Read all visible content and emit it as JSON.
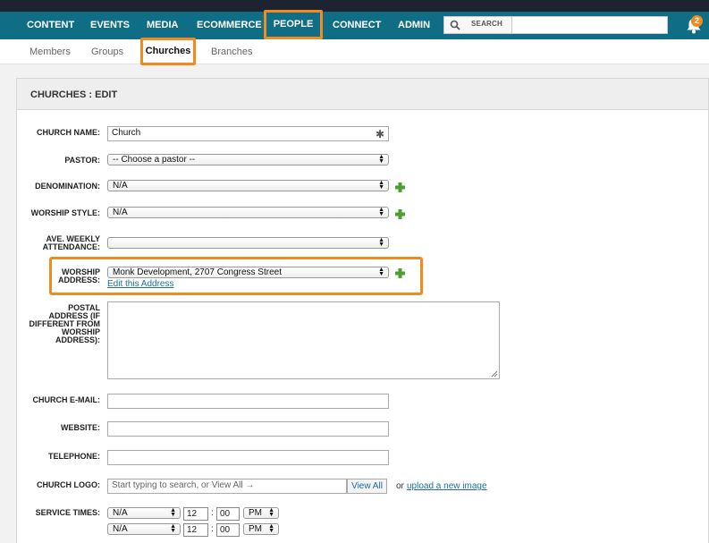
{
  "nav": {
    "items": [
      "CONTENT",
      "EVENTS",
      "MEDIA",
      "ECOMMERCE",
      "PEOPLE",
      "CONNECT",
      "ADMIN"
    ],
    "search_label": "SEARCH",
    "search_value": "",
    "notification_count": "2"
  },
  "subnav": {
    "items": [
      "Members",
      "Groups",
      "Churches",
      "Branches"
    ],
    "active": "Churches"
  },
  "panel": {
    "title": "CHURCHES : EDIT"
  },
  "form": {
    "church_name": {
      "label": "CHURCH NAME:",
      "value": "Church",
      "required_icon": "asterisk-icon"
    },
    "pastor": {
      "label": "PASTOR:",
      "value": "-- Choose a pastor --"
    },
    "denomination": {
      "label": "DENOMINATION:",
      "value": "N/A"
    },
    "worship_style": {
      "label": "WORSHIP STYLE:",
      "value": "N/A"
    },
    "attendance": {
      "label_line1": "AVE. WEEKLY",
      "label_line2": "ATTENDANCE:",
      "value": ""
    },
    "worship_address": {
      "label_line1": "WORSHIP",
      "label_line2": "ADDRESS:",
      "value": "Monk Development, 2707 Congress Street",
      "edit_link": "Edit this Address"
    },
    "postal_address": {
      "label_lines": [
        "POSTAL",
        "ADDRESS (IF",
        "DIFFERENT FROM",
        "WORSHIP",
        "ADDRESS):"
      ],
      "value": ""
    },
    "email": {
      "label": "CHURCH E-MAIL:",
      "value": ""
    },
    "website": {
      "label": "WEBSITE:",
      "value": ""
    },
    "telephone": {
      "label": "TELEPHONE:",
      "value": ""
    },
    "logo": {
      "label": "CHURCH LOGO:",
      "placeholder": "Start typing to search, or View All →",
      "view_all": "View All",
      "or_text": "or",
      "upload_link": "upload a new image"
    },
    "service_times": {
      "label": "SERVICE TIMES:",
      "rows": [
        {
          "day": "N/A",
          "hour": "12",
          "minute": "00",
          "ampm": "PM"
        },
        {
          "day": "N/A",
          "hour": "12",
          "minute": "00",
          "ampm": "PM"
        }
      ],
      "separator": ":"
    }
  },
  "colors": {
    "nav_bg": "#0f6e85",
    "highlight": "#f28a1e",
    "link": "#1a6f9a",
    "add_icon": "#4aa02c"
  }
}
